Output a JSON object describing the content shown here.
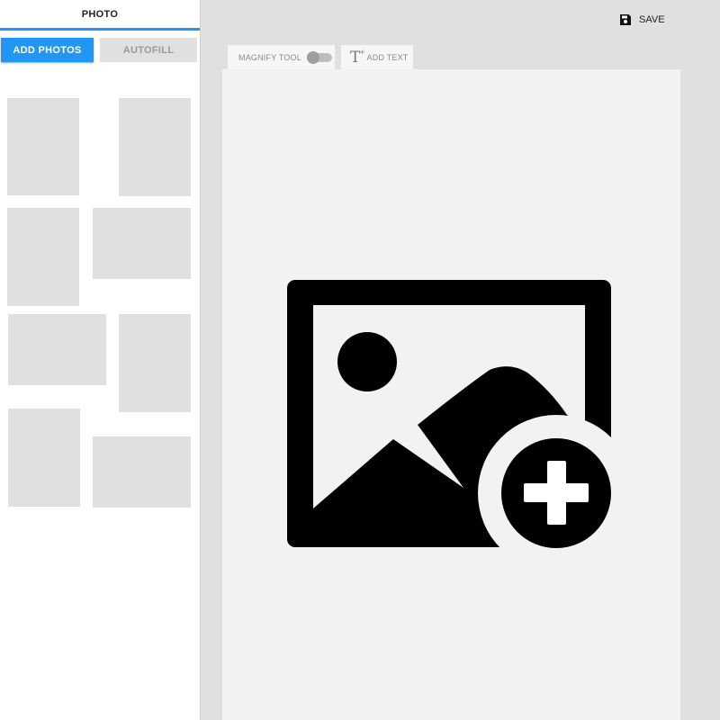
{
  "sidebar": {
    "tab_label": "PHOTO",
    "add_photos_label": "ADD PHOTOS",
    "autofill_label": "AUTOFILL",
    "thumbnail_count": 8
  },
  "toolbar": {
    "save_label": "SAVE",
    "magnify_label": "MAGNIFY TOOL",
    "magnify_enabled": false,
    "add_text_label": "ADD TEXT"
  },
  "canvas": {
    "placeholder_icon": "add-photo-icon"
  },
  "colors": {
    "accent": "#2196f3",
    "thumbnail": "#e0e0e0",
    "canvas": "#f2f2f2",
    "workspace": "#e0e0e0"
  }
}
